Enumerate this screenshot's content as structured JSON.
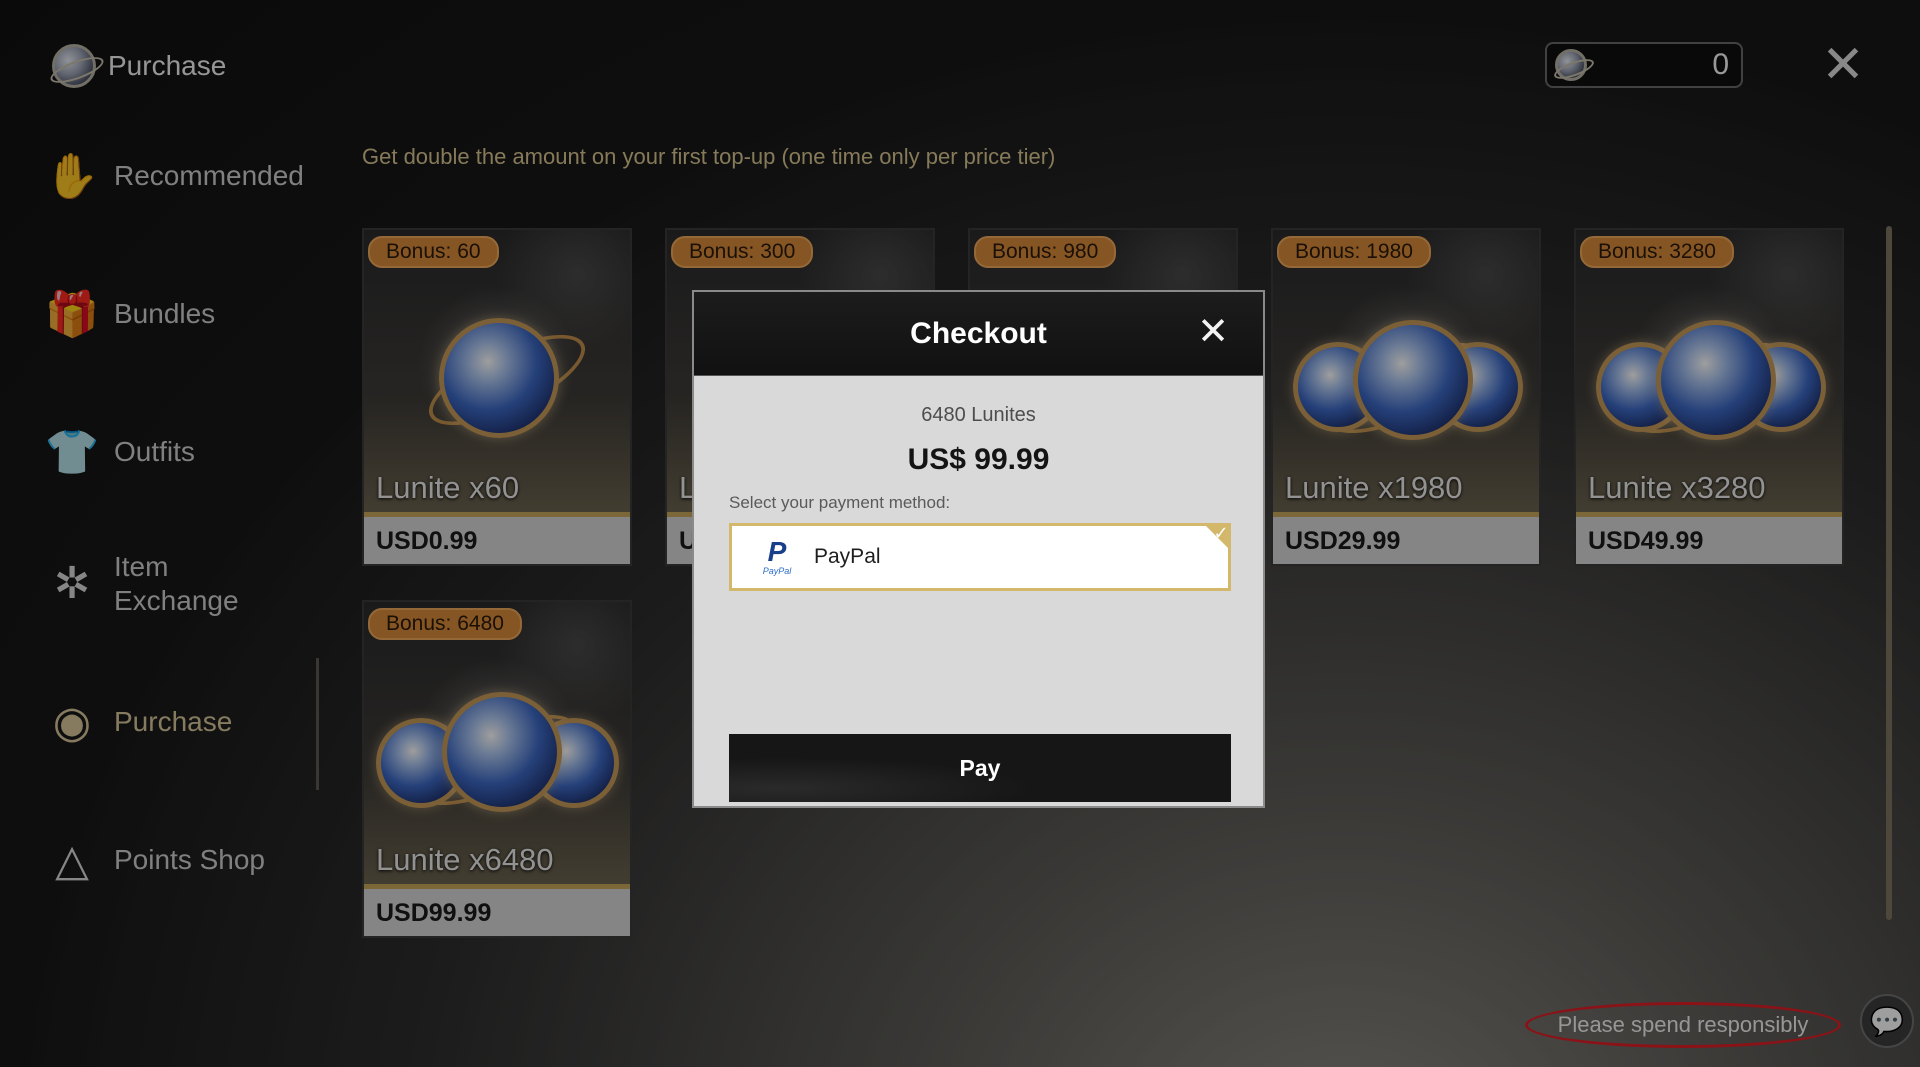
{
  "header": {
    "title": "Purchase",
    "currency_value": "0",
    "close_icon": "x-close-icon"
  },
  "sidebar": {
    "items": [
      {
        "label": "Recommended",
        "icon": "recommended-icon"
      },
      {
        "label": "Bundles",
        "icon": "gift-icon"
      },
      {
        "label": "Outfits",
        "icon": "shirt-icon"
      },
      {
        "label": "Item\nExchange",
        "label1": "Item",
        "label2": "Exchange",
        "icon": "tree-icon"
      },
      {
        "label": "Purchase",
        "icon": "orb-icon",
        "active": true
      },
      {
        "label": "Points Shop",
        "icon": "triangle-icon"
      }
    ]
  },
  "promo": "Get double the amount on your first top-up (one time only per price tier)",
  "cards": [
    {
      "bonus": "Bonus: 60",
      "name": "Lunite x60",
      "price": "USD0.99"
    },
    {
      "bonus": "Bonus: 300",
      "name": "L",
      "price": "U"
    },
    {
      "bonus": "Bonus: 980",
      "name": "",
      "price": ""
    },
    {
      "bonus": "Bonus: 1980",
      "name": "Lunite x1980",
      "price": "USD29.99"
    },
    {
      "bonus": "Bonus: 3280",
      "name": "Lunite x3280",
      "price": "USD49.99"
    },
    {
      "bonus": "Bonus: 6480",
      "name": "Lunite x6480",
      "price": "USD99.99"
    }
  ],
  "footer": {
    "spend_text": "Please spend responsibly",
    "chat_icon": "chat-icon"
  },
  "modal": {
    "title": "Checkout",
    "item_name": "6480 Lunites",
    "item_price": "US$ 99.99",
    "select_label": "Select your payment method:",
    "payment_option": "PayPal",
    "pay_button": "Pay"
  },
  "colors": {
    "accent_gold": "#d3b76a",
    "bonus_orange": "#d98a3a",
    "highlight_red": "#e01d24"
  }
}
